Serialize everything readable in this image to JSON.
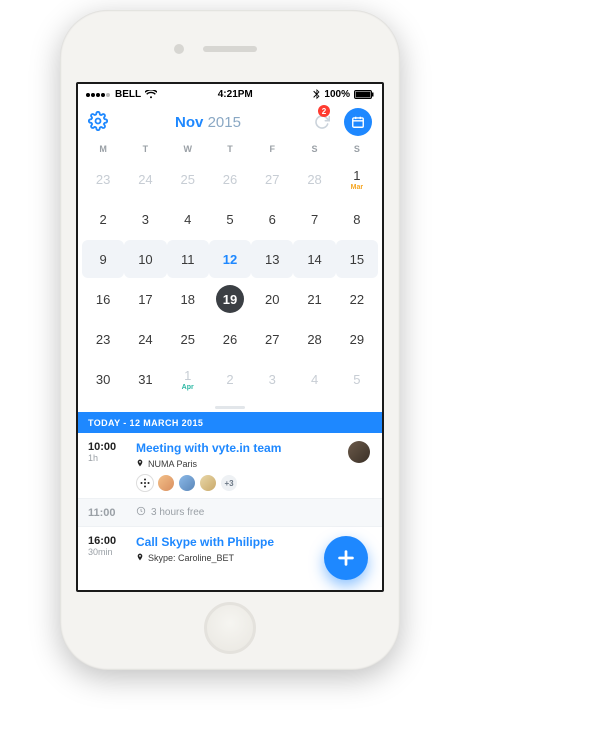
{
  "status": {
    "carrier": "BELL",
    "time": "4:21PM",
    "battery": "100%"
  },
  "header": {
    "month": "Nov",
    "year": "2015",
    "notification_count": "2"
  },
  "weekdays": [
    "M",
    "T",
    "W",
    "T",
    "F",
    "S",
    "S"
  ],
  "calendar": {
    "rows": [
      [
        {
          "n": "23",
          "faded": true
        },
        {
          "n": "24",
          "faded": true
        },
        {
          "n": "25",
          "faded": true
        },
        {
          "n": "26",
          "faded": true
        },
        {
          "n": "27",
          "faded": true
        },
        {
          "n": "28",
          "faded": true
        },
        {
          "n": "1",
          "sub": "Mar",
          "subColor": "orange"
        }
      ],
      [
        {
          "n": "2"
        },
        {
          "n": "3"
        },
        {
          "n": "4"
        },
        {
          "n": "5"
        },
        {
          "n": "6"
        },
        {
          "n": "7"
        },
        {
          "n": "8"
        }
      ],
      [
        {
          "n": "9",
          "hl": true
        },
        {
          "n": "10",
          "hl": true
        },
        {
          "n": "11",
          "hl": true
        },
        {
          "n": "12",
          "hl": true,
          "blue": true
        },
        {
          "n": "13",
          "hl": true
        },
        {
          "n": "14",
          "hl": true
        },
        {
          "n": "15",
          "hl": true
        }
      ],
      [
        {
          "n": "16"
        },
        {
          "n": "17"
        },
        {
          "n": "18"
        },
        {
          "n": "19",
          "today": true
        },
        {
          "n": "20"
        },
        {
          "n": "21"
        },
        {
          "n": "22"
        }
      ],
      [
        {
          "n": "23"
        },
        {
          "n": "24"
        },
        {
          "n": "25"
        },
        {
          "n": "26"
        },
        {
          "n": "27"
        },
        {
          "n": "28"
        },
        {
          "n": "29"
        }
      ],
      [
        {
          "n": "30"
        },
        {
          "n": "31"
        },
        {
          "n": "1",
          "faded": true,
          "sub": "Apr",
          "subColor": "teal"
        },
        {
          "n": "2",
          "faded": true
        },
        {
          "n": "3",
          "faded": true
        },
        {
          "n": "4",
          "faded": true
        },
        {
          "n": "5",
          "faded": true
        }
      ]
    ]
  },
  "today_bar": "TODAY - 12 MARCH 2015",
  "events": [
    {
      "time": "10:00",
      "duration": "1h",
      "title": "Meeting with vyte.in team",
      "location": "NUMA Paris",
      "avatars_extra": "+3"
    }
  ],
  "free_slot": {
    "time": "11:00",
    "label": "3 hours free"
  },
  "event2": {
    "time": "16:00",
    "duration": "30min",
    "title": "Call Skype with Philippe",
    "location": "Skype: Caroline_BET"
  },
  "colors": {
    "accent": "#1e88ff",
    "orange": "#f5a623",
    "teal": "#2bb7a3"
  }
}
